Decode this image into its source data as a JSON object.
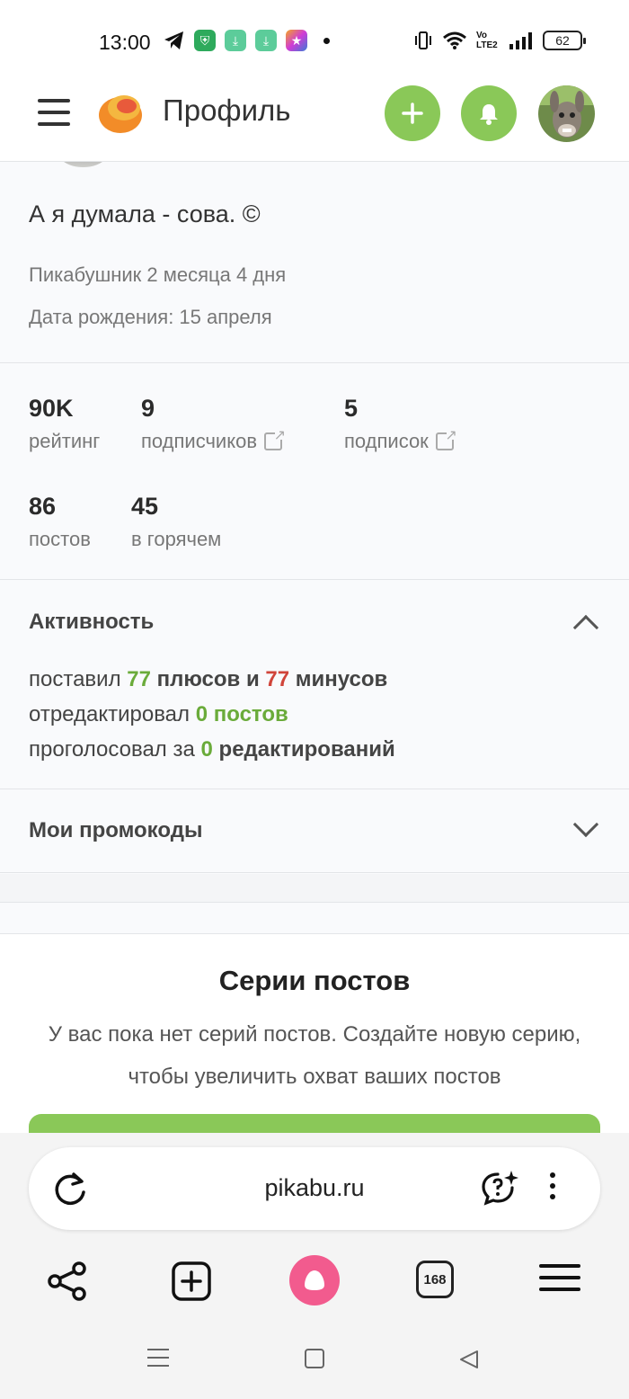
{
  "status_bar": {
    "time": "13:00",
    "network": "Vo LTE2",
    "battery": "62"
  },
  "header": {
    "title": "Профиль"
  },
  "profile": {
    "status_text": "А я думала - сова. ©",
    "member_for": "Пикабушник 2 месяца 4 дня",
    "birthday": "Дата рождения: 15 апреля"
  },
  "stats": [
    {
      "value": "90K",
      "label": "рейтинг"
    },
    {
      "value": "9",
      "label": "подписчиков"
    },
    {
      "value": "5",
      "label": "подписок"
    },
    {
      "value": "86",
      "label": "постов"
    },
    {
      "value": "45",
      "label": "в горячем"
    }
  ],
  "activity": {
    "title": "Активность",
    "line1": {
      "prefix": "поставил ",
      "plus_count": "77",
      "mid": " плюсов и ",
      "minus_count": "77",
      "suffix": " минусов"
    },
    "line2": {
      "prefix": "отредактировал ",
      "count": "0",
      "suffix": " постов"
    },
    "line3": {
      "prefix": "проголосовал за ",
      "count": "0",
      "suffix": " редактирований"
    }
  },
  "promocodes": {
    "title": "Мои промокоды"
  },
  "series": {
    "title": "Серии постов",
    "text": "У вас пока нет серий постов. Создайте новую серию, чтобы увеличить охват ваших постов"
  },
  "browser": {
    "url": "pikabu.ru",
    "tabs_count": "168"
  },
  "colors": {
    "accent_green": "#8ac858",
    "plus_green": "#6aab3a",
    "minus_red": "#d0443a",
    "alice_pink": "#f25b8e"
  }
}
